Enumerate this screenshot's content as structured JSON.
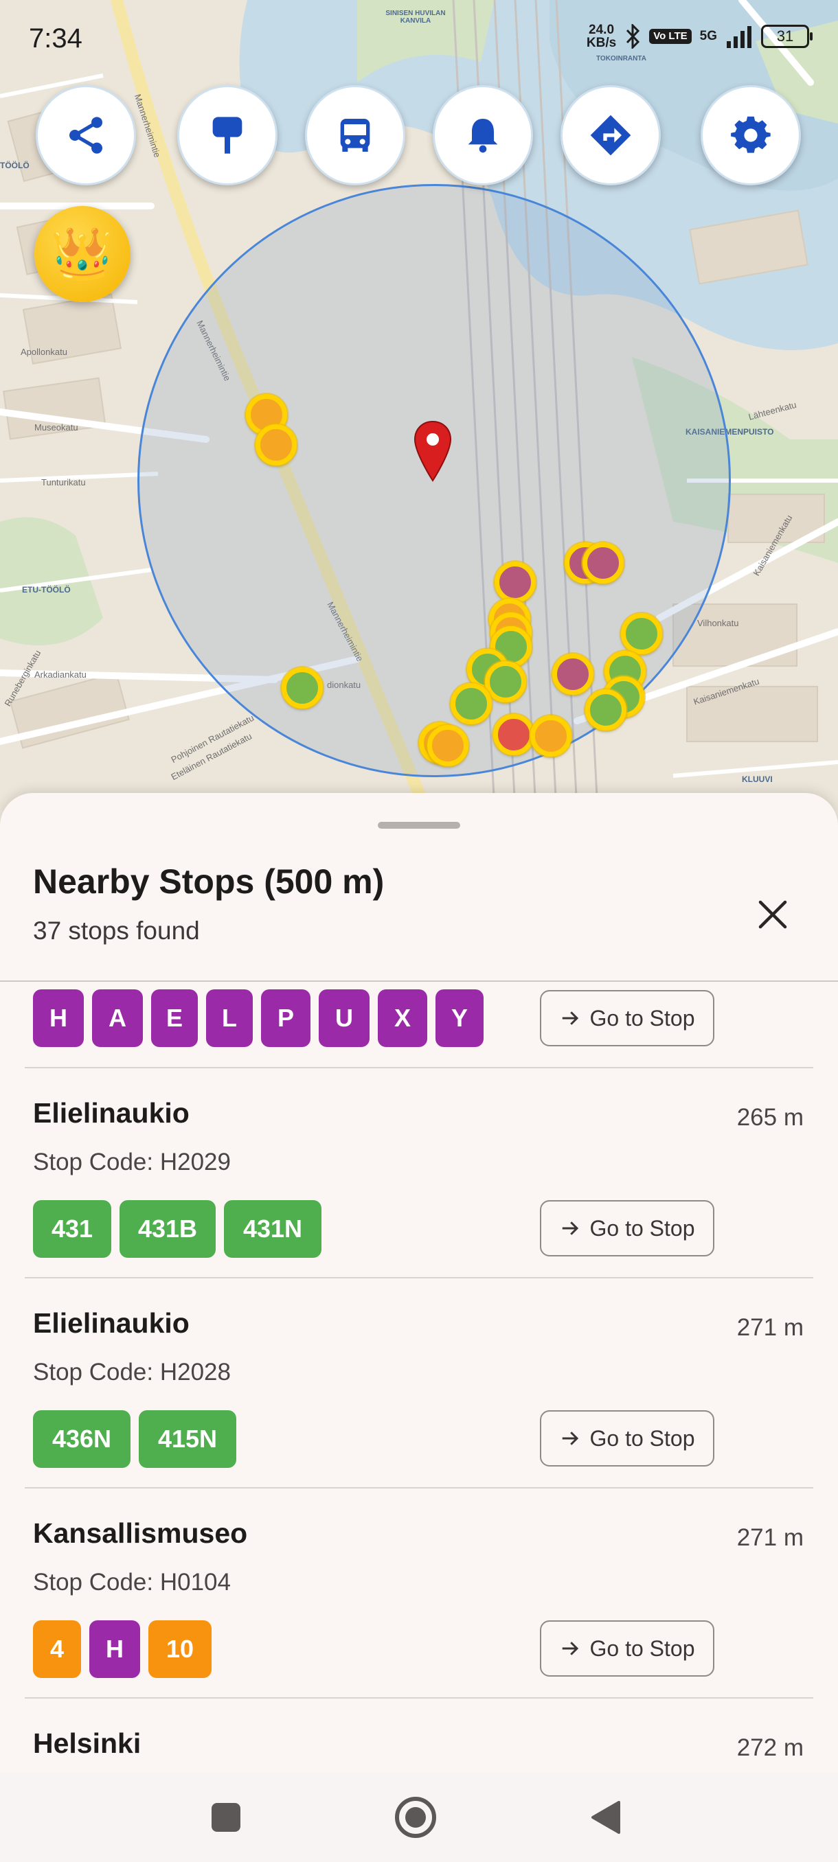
{
  "status_bar": {
    "time": "7:34",
    "net_speed_value": "24.0",
    "net_speed_unit": "KB/s",
    "volte": "Vo LTE",
    "signal": "5G",
    "battery": "31"
  },
  "map": {
    "street_labels": [
      "Mannerheimintie",
      "Mannerheimintie",
      "Mannerheimintie",
      "dionkatu",
      "Pohjoinen Rautatiekatu",
      "Eteläinen Rautatiekatu",
      "Arkadiankatu",
      "Runeberginkatu",
      "Museokatu",
      "Tunturikatu",
      "Apollonkatu",
      "Vilhonkatu",
      "Kaisaniemenkatu",
      "Kaisaniemenkatu",
      "Lähteenkatu"
    ],
    "area_labels": [
      "ETU-TÖÖLÖ",
      "KAISANIEMENPUISTO",
      "KLUUVI",
      "TÖÖLÖ",
      "SINISEN HUVILAN KANVILA",
      "TOKOINRANTA"
    ],
    "accent_color": "#4a86d8"
  },
  "toolbar": {
    "buttons": [
      {
        "name": "share",
        "icon": "share-icon"
      },
      {
        "name": "stop-sign",
        "icon": "bus-stop-sign-icon"
      },
      {
        "name": "bus",
        "icon": "bus-icon"
      },
      {
        "name": "notifications",
        "icon": "bell-icon"
      },
      {
        "name": "directions",
        "icon": "directions-icon"
      },
      {
        "name": "settings",
        "icon": "gear-icon"
      }
    ],
    "premium_icon": "crown-icon",
    "premium_glyph": "👑"
  },
  "sheet": {
    "title": "Nearby Stops (500 m)",
    "subtitle": "37 stops found",
    "goto_label": "Go to Stop",
    "first_row_routes": [
      "H",
      "A",
      "E",
      "L",
      "P",
      "U",
      "X",
      "Y"
    ],
    "stops": [
      {
        "name": "Elielinaukio",
        "distance": "265 m",
        "code": "Stop Code: H2029",
        "routes": [
          "431",
          "431B",
          "431N"
        ]
      },
      {
        "name": "Elielinaukio",
        "distance": "271 m",
        "code": "Stop Code: H2028",
        "routes": [
          "436N",
          "415N"
        ]
      },
      {
        "name": "Kansallismuseo",
        "distance": "271 m",
        "code": "Stop Code: H0104",
        "routes": [
          "4",
          "H",
          "10"
        ]
      },
      {
        "name": "Helsinki",
        "distance": "272 m"
      }
    ]
  },
  "colors": {
    "route_purple": "#9b2aa8",
    "route_green": "#4fae4e",
    "route_orange": "#f7930f"
  }
}
